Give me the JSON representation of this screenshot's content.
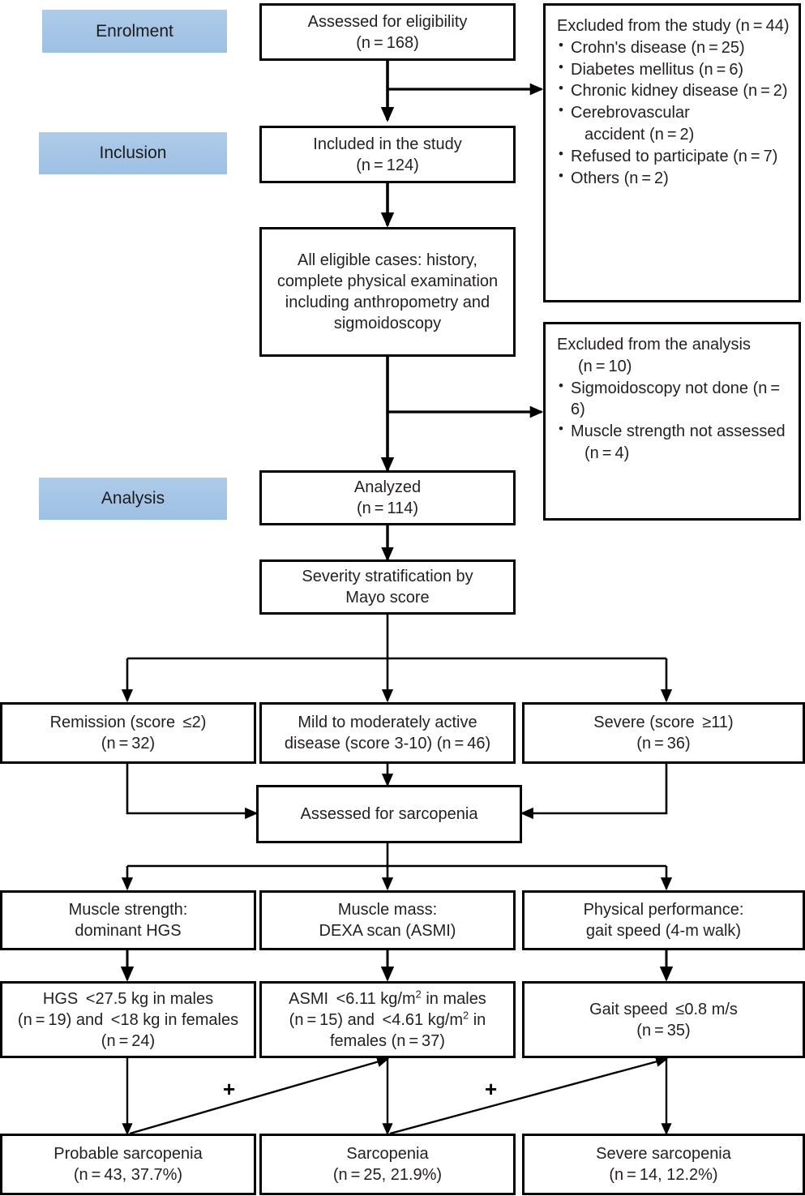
{
  "diagram": {
    "title": "Study participant flow diagram",
    "type": "consort-flowchart",
    "colors": {
      "stage_label_fill": "#a3c6e8",
      "box_border": "#000000",
      "box_fill": "#ffffff",
      "text": "#231f20"
    }
  },
  "stages": [
    {
      "label": "Enrolment"
    },
    {
      "label": "Inclusion"
    },
    {
      "label": "Analysis"
    }
  ],
  "nodes": {
    "assessed": {
      "line1": "Assessed for eligibility",
      "line2": "(n = 168)"
    },
    "included": {
      "line1": "Included in the study",
      "line2": "(n = 124)"
    },
    "eligible_cases": {
      "line1": "All eligible cases: history,",
      "line2": "complete physical examination",
      "line3": "including anthropometry and",
      "line4": "sigmoidoscopy"
    },
    "analyzed": {
      "line1": "Analyzed",
      "line2": "(n = 114)"
    },
    "severity": {
      "line1": "Severity stratification by",
      "line2": "Mayo score"
    },
    "assessed_sarcopenia": {
      "line1": "Assessed for sarcopenia"
    }
  },
  "excluded_study": {
    "heading": "Excluded from the study (n = 44)",
    "items": [
      "Crohn's disease (n = 25)",
      "Diabetes mellitus (n = 6)",
      "Chronic kidney disease (n = 2)",
      "Cerebrovascular",
      "accident (n = 2)",
      "Refused to participate (n = 7)",
      "Others (n = 2)"
    ]
  },
  "excluded_analysis": {
    "heading_line1": "Excluded from the analysis",
    "heading_line2": "(n = 10)",
    "items": [
      "Sigmoidoscopy not done (n = 6)",
      "Muscle strength not assessed",
      "(n = 4)"
    ]
  },
  "severity_groups": [
    {
      "line1": "Remission (score  ≤2)",
      "line2": "(n = 32)",
      "n": 32,
      "score": "≤2"
    },
    {
      "line1": "Mild to moderately active",
      "line2": "disease (score 3-10) (n = 46)",
      "n": 46,
      "score": "3-10"
    },
    {
      "line1": "Severe (score  ≥11)",
      "line2": "(n = 36)",
      "n": 36,
      "score": "≥11"
    }
  ],
  "measures": [
    {
      "line1": "Muscle strength:",
      "line2": "dominant HGS"
    },
    {
      "line1": "Muscle mass:",
      "line2": "DEXA scan (ASMI)"
    },
    {
      "line1": "Physical performance:",
      "line2": "gait speed (4-m walk)"
    }
  ],
  "cutoffs": {
    "hgs": {
      "line1": "HGS  <27.5 kg in males",
      "line2": "(n = 19) and  <18 kg in females",
      "line3": "(n = 24)"
    },
    "asmi": {
      "line1_pre": "ASMI  <6.11 kg/m",
      "line1_sup": "2",
      "line1_post": " in males",
      "line2_pre": "(n = 15) and  <4.61 kg/m",
      "line2_sup": "2",
      "line2_post": " in",
      "line3": "females (n = 37)"
    },
    "gait": {
      "line1": "Gait speed  ≤0.8 m/s",
      "line2": "(n = 35)"
    }
  },
  "outcomes": [
    {
      "line1": "Probable sarcopenia",
      "line2": "(n = 43, 37.7%)",
      "n": 43,
      "percent": "37.7%"
    },
    {
      "line1": "Sarcopenia",
      "line2": "(n = 25, 21.9%)",
      "n": 25,
      "percent": "21.9%"
    },
    {
      "line1": "Severe sarcopenia",
      "line2": "(n = 14, 12.2%)",
      "n": 14,
      "percent": "12.2%"
    }
  ],
  "operators": [
    {
      "symbol": "+"
    },
    {
      "symbol": "+"
    }
  ]
}
